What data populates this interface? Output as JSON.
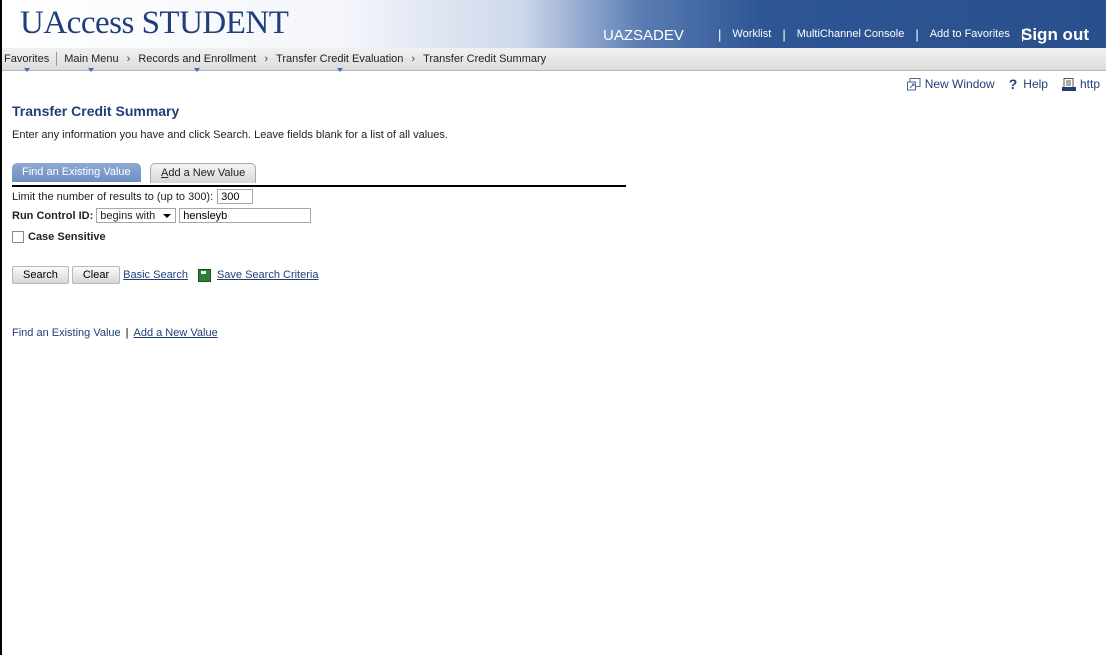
{
  "banner": {
    "logo_u": "U",
    "logo_access": "Access",
    "logo_student": "STUDENT",
    "env": "UAZSADEV",
    "links": [
      "Worklist",
      "MultiChannel Console",
      "Add to Favorites"
    ],
    "signout": "Sign out"
  },
  "breadcrumb": {
    "favorites": "Favorites",
    "main_menu": "Main Menu",
    "records": "Records and Enrollment",
    "transfer_eval": "Transfer Credit Evaluation",
    "current": "Transfer Credit Summary"
  },
  "utility": {
    "new_window": "New Window",
    "help": "Help",
    "http": "http"
  },
  "page": {
    "title": "Transfer Credit Summary",
    "instructions": "Enter any information you have and click Search. Leave fields blank for a list of all values."
  },
  "tabs": {
    "find": "Find an Existing Value",
    "add_prefix": "A",
    "add_rest": "dd a New Value"
  },
  "form": {
    "limit_label": "Limit the number of results to (up to 300):",
    "limit_value": "300",
    "run_control_label": "Run Control ID:",
    "operator": "begins with",
    "run_control_value": "hensleyb",
    "case_label": "Case Sensitive"
  },
  "actions": {
    "search": "Search",
    "clear": "Clear",
    "basic_search": "Basic Search",
    "save_criteria": "Save Search Criteria"
  },
  "footer": {
    "find": "Find an Existing Value",
    "add": "Add a New Value"
  },
  "colors": {
    "brand_blue": "#1f3f7a",
    "banner_blue": "#2a4f8c",
    "tab_active": "#7a98c9"
  }
}
